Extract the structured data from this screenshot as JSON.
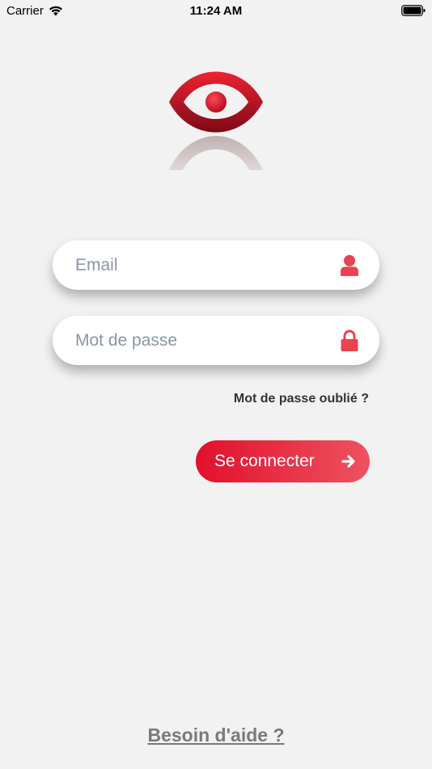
{
  "status_bar": {
    "carrier": "Carrier",
    "time": "11:24 AM"
  },
  "login": {
    "email_placeholder": "Email",
    "password_placeholder": "Mot de passe",
    "forgot_password": "Mot de passe oublié ?",
    "connect_label": "Se connecter",
    "help_link": "Besoin d'aide ?"
  },
  "icons": {
    "email": "user-icon",
    "password": "lock-icon",
    "connect": "arrow-right-icon",
    "logo": "eye-logo"
  },
  "colors": {
    "accent": "#e2102c",
    "accent_light": "#ee5260",
    "background": "#f2f2f2",
    "placeholder": "#8a96a4"
  }
}
